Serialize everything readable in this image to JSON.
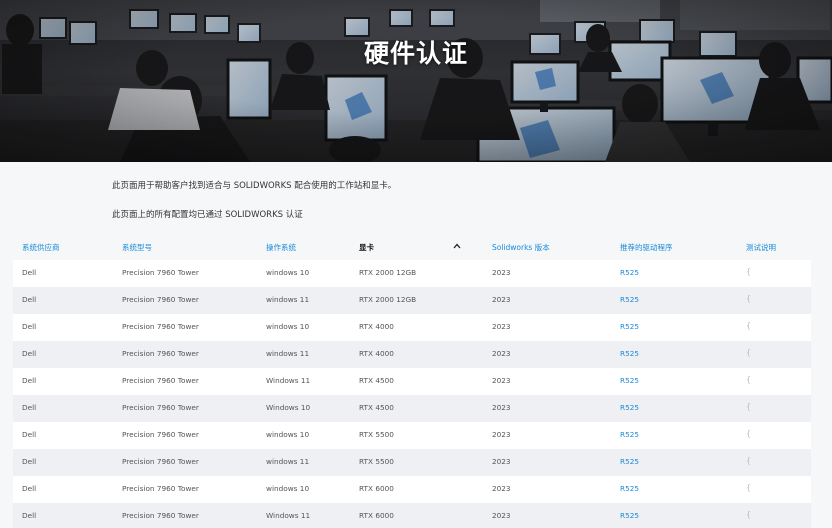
{
  "hero": {
    "title": "硬件认证"
  },
  "intro": {
    "line1": "此页面用于帮助客户找到适合与 SOLIDWORKS 配合使用的工作站和显卡。",
    "line2": "此页面上的所有配置均已通过 SOLIDWORKS 认证"
  },
  "table": {
    "headers": {
      "vendor": "系统供应商",
      "model": "系统型号",
      "os": "操作系统",
      "gpu": "显卡",
      "sw_version": "Solidworks 版本",
      "driver": "推荐的驱动程序",
      "notes": "测试说明"
    },
    "sort_icon": "chevron-up-icon",
    "rows": [
      {
        "vendor": "Dell",
        "model": "Precision 7960 Tower",
        "os": "windows 10",
        "gpu": "RTX 2000 12GB",
        "sw": "2023",
        "driver": "R525",
        "note": "{"
      },
      {
        "vendor": "Dell",
        "model": "Precision 7960 Tower",
        "os": "windows 11",
        "gpu": "RTX 2000 12GB",
        "sw": "2023",
        "driver": "R525",
        "note": "{"
      },
      {
        "vendor": "Dell",
        "model": "Precision 7960 Tower",
        "os": "windows 10",
        "gpu": "RTX 4000",
        "sw": "2023",
        "driver": "R525",
        "note": "{"
      },
      {
        "vendor": "Dell",
        "model": "Precision 7960 Tower",
        "os": "windows 11",
        "gpu": "RTX 4000",
        "sw": "2023",
        "driver": "R525",
        "note": "{"
      },
      {
        "vendor": "Dell",
        "model": "Precision 7960 Tower",
        "os": "Windows 11",
        "gpu": "RTX 4500",
        "sw": "2023",
        "driver": "R525",
        "note": "{"
      },
      {
        "vendor": "Dell",
        "model": "Precision 7960 Tower",
        "os": "Windows 10",
        "gpu": "RTX 4500",
        "sw": "2023",
        "driver": "R525",
        "note": "{"
      },
      {
        "vendor": "Dell",
        "model": "Precision 7960 Tower",
        "os": "windows 10",
        "gpu": "RTX 5500",
        "sw": "2023",
        "driver": "R525",
        "note": "{"
      },
      {
        "vendor": "Dell",
        "model": "Precision 7960 Tower",
        "os": "windows 11",
        "gpu": "RTX 5500",
        "sw": "2023",
        "driver": "R525",
        "note": "{"
      },
      {
        "vendor": "Dell",
        "model": "Precision 7960 Tower",
        "os": "windows 10",
        "gpu": "RTX 6000",
        "sw": "2023",
        "driver": "R525",
        "note": "{"
      },
      {
        "vendor": "Dell",
        "model": "Precision 7960 Tower",
        "os": "Windows 11",
        "gpu": "RTX 6000",
        "sw": "2023",
        "driver": "R525",
        "note": "{"
      }
    ]
  },
  "colors": {
    "link": "#1a8ad8",
    "row_even": "#eef0f3",
    "row_odd": "#ffffff",
    "page_bg": "#f5f7f9"
  }
}
